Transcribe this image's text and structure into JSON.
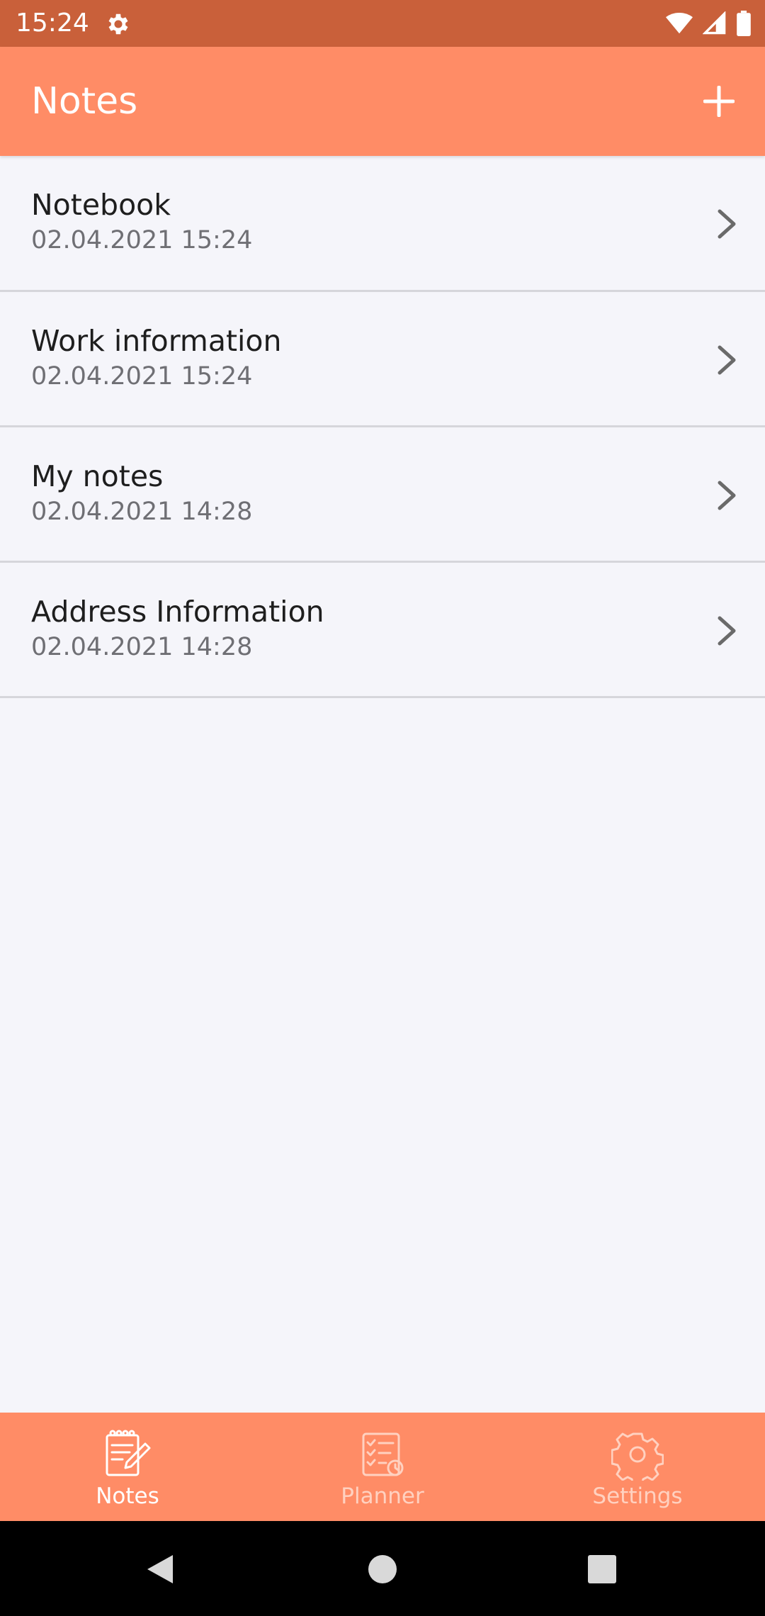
{
  "status_bar": {
    "time": "15:24",
    "icons": [
      "gear-icon",
      "wifi-icon",
      "signal-icon",
      "battery-icon"
    ]
  },
  "app_bar": {
    "title": "Notes",
    "add_icon": "plus-icon"
  },
  "notes": [
    {
      "title": "Notebook",
      "date": "02.04.2021 15:24"
    },
    {
      "title": "Work information",
      "date": "02.04.2021 15:24"
    },
    {
      "title": "My notes",
      "date": "02.04.2021 14:28"
    },
    {
      "title": "Address Information",
      "date": "02.04.2021 14:28"
    }
  ],
  "bottom_nav": {
    "items": [
      {
        "label": "Notes",
        "icon": "notepad-icon",
        "active": true
      },
      {
        "label": "Planner",
        "icon": "checklist-icon",
        "active": false
      },
      {
        "label": "Settings",
        "icon": "gear-icon",
        "active": false
      }
    ]
  },
  "system_nav": {
    "icons": [
      "back-icon",
      "home-icon",
      "recents-icon"
    ]
  },
  "colors": {
    "status_bar": "#c9603a",
    "accent": "#ff8c66",
    "background": "#f5f5fa",
    "divider": "#d6d6db"
  }
}
